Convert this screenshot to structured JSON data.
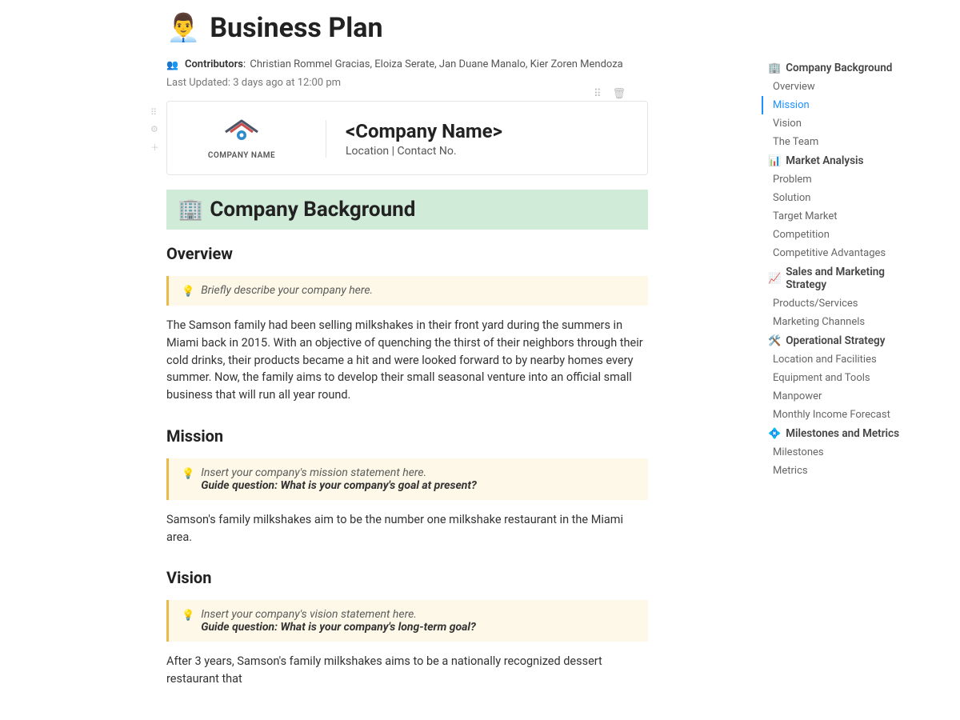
{
  "page": {
    "icon": "👨‍💼",
    "title": "Business Plan"
  },
  "contributors": {
    "label": "Contributors",
    "names": "Christian Rommel Gracias, Eloiza Serate, Jan Duane Manalo, Kier Zoren Mendoza"
  },
  "last_updated": "Last Updated: 3 days ago at 12:00 pm",
  "company_card": {
    "logo_caption": "COMPANY NAME",
    "name": "<Company Name>",
    "location_contact": "Location | Contact No."
  },
  "sections": {
    "company_bg": {
      "icon": "🏢",
      "title": "Company Background"
    },
    "overview": {
      "heading": "Overview",
      "callout": "Briefly describe your company here.",
      "body": "The Samson family had been selling milkshakes in their front yard during the summers in Miami back in 2015. With an objective of quenching the thirst of their neighbors through their cold drinks, their products became a hit and were looked forward to by nearby homes every summer. Now, the family aims to develop their small seasonal venture into an official small business that will run all year round."
    },
    "mission": {
      "heading": "Mission",
      "callout_line1": "Insert your company's mission statement here.",
      "callout_guide": "Guide question: What is your company's goal at present?",
      "body": "Samson's family milkshakes aim to be the number one milkshake restaurant in the Miami area."
    },
    "vision": {
      "heading": "Vision",
      "callout_line1": "Insert your company's vision statement here.",
      "callout_guide": "Guide question: What is your company's long-term goal?",
      "body": "After 3 years, Samson's family milkshakes aims to be a nationally recognized dessert restaurant that"
    }
  },
  "toc": {
    "h1": {
      "icon": "🏢",
      "label": "Company Background"
    },
    "i11": "Overview",
    "i12": "Mission",
    "i13": "Vision",
    "i14": "The Team",
    "h2": {
      "icon": "📊",
      "label": "Market Analysis"
    },
    "i21": "Problem",
    "i22": "Solution",
    "i23": "Target Market",
    "i24": "Competition",
    "i25": "Competitive Advantages",
    "h3": {
      "icon": "📈",
      "label": "Sales and Marketing Strategy"
    },
    "i31": "Products/Services",
    "i32": "Marketing Channels",
    "h4": {
      "icon": "🛠️",
      "label": "Operational Strategy"
    },
    "i41": "Location and Facilities",
    "i42": "Equipment and Tools",
    "i43": "Manpower",
    "i44": "Monthly Income Forecast",
    "h5": {
      "icon": "💠",
      "label": "Milestones and Metrics"
    },
    "i51": "Milestones",
    "i52": "Metrics"
  }
}
